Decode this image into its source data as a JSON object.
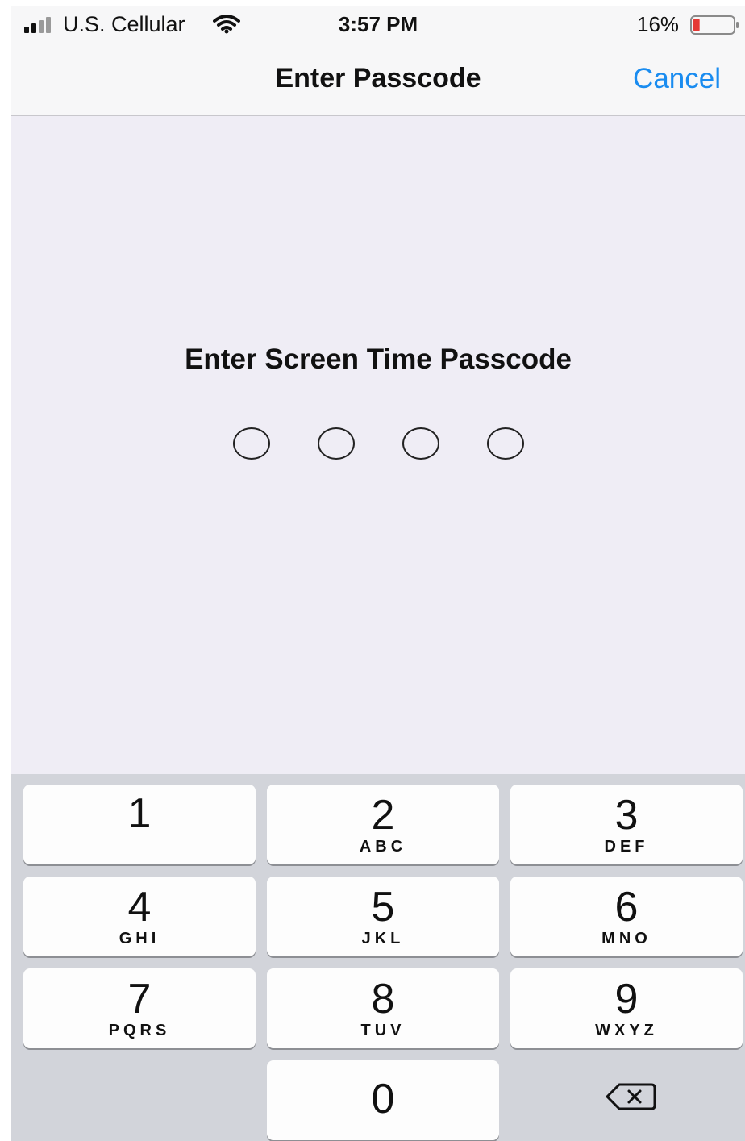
{
  "status_bar": {
    "carrier": "U.S. Cellular",
    "time": "3:57 PM",
    "battery_percent": "16%",
    "battery_level": 0.16,
    "icons": [
      "signal-icon",
      "wifi-icon",
      "battery-icon"
    ]
  },
  "nav": {
    "title": "Enter Passcode",
    "cancel_label": "Cancel"
  },
  "prompt": {
    "title": "Enter Screen Time Passcode",
    "digits_entered": 0,
    "digits_total": 4
  },
  "keypad": {
    "keys": [
      {
        "digit": "1",
        "letters": ""
      },
      {
        "digit": "2",
        "letters": "ABC"
      },
      {
        "digit": "3",
        "letters": "DEF"
      },
      {
        "digit": "4",
        "letters": "GHI"
      },
      {
        "digit": "5",
        "letters": "JKL"
      },
      {
        "digit": "6",
        "letters": "MNO"
      },
      {
        "digit": "7",
        "letters": "PQRS"
      },
      {
        "digit": "8",
        "letters": "TUV"
      },
      {
        "digit": "9",
        "letters": "WXYZ"
      },
      {
        "digit": "0",
        "letters": ""
      }
    ],
    "delete_icon": "delete-backspace-icon"
  },
  "colors": {
    "accent": "#1a8cf0",
    "background": "#efedf5",
    "keypad_background": "#d2d4da",
    "battery_low": "#e53935"
  }
}
